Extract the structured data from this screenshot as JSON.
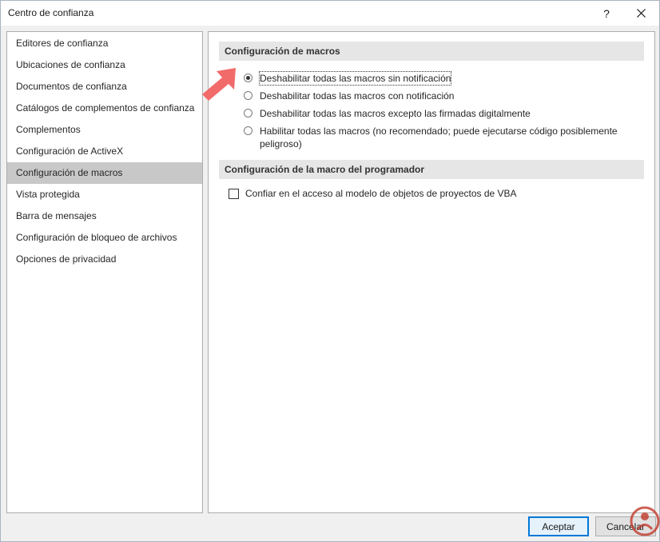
{
  "window": {
    "title": "Centro de confianza",
    "help_label": "?"
  },
  "sidebar": {
    "items": [
      {
        "label": "Editores de confianza"
      },
      {
        "label": "Ubicaciones de confianza"
      },
      {
        "label": "Documentos de confianza"
      },
      {
        "label": "Catálogos de complementos de confianza"
      },
      {
        "label": "Complementos"
      },
      {
        "label": "Configuración de ActiveX"
      },
      {
        "label": "Configuración de macros",
        "selected": true
      },
      {
        "label": "Vista protegida"
      },
      {
        "label": "Barra de mensajes"
      },
      {
        "label": "Configuración de bloqueo de archivos"
      },
      {
        "label": "Opciones de privacidad"
      }
    ]
  },
  "main": {
    "macro_section": {
      "title": "Configuración de macros",
      "options": [
        {
          "label": "Deshabilitar todas las macros sin notificación",
          "checked": true
        },
        {
          "label": "Deshabilitar todas las macros con notificación",
          "checked": false
        },
        {
          "label": "Deshabilitar todas las macros excepto las firmadas digitalmente",
          "checked": false
        },
        {
          "label": "Habilitar todas las macros (no recomendado; puede ejecutarse código posiblemente peligroso)",
          "checked": false
        }
      ]
    },
    "developer_section": {
      "title": "Configuración de la macro del programador",
      "vba_access_label": "Confiar en el acceso al modelo de objetos de proyectos de VBA",
      "vba_access_checked": false
    }
  },
  "footer": {
    "ok_label": "Aceptar",
    "cancel_label": "Cancelar"
  },
  "colors": {
    "accent": "#0078d7",
    "arrow": "#f26b6b",
    "watermark": "#c0392b",
    "selected_nav": "#c8c8c8"
  },
  "icons": {
    "close": "close-icon",
    "arrow": "pointer-arrow-icon",
    "watermark": "brand-logo-icon"
  }
}
